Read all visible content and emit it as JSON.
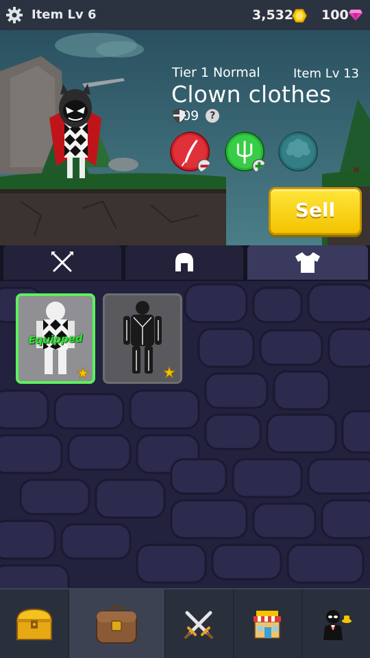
{
  "topbar": {
    "settings_icon": "gear-icon",
    "item_level": "Item Lv 6",
    "gold": "3,532",
    "gems": "100",
    "gold_icon": "gold-coin-icon",
    "gem_icon": "pink-gem-icon"
  },
  "item": {
    "tier": "Tier 1 Normal",
    "item_level": "Item Lv 13",
    "name": "Clown clothes",
    "defense": "109",
    "help": "?"
  },
  "stats": [
    {
      "icon": "feather-minus-icon",
      "color": "#d0202a"
    },
    {
      "icon": "trident-plus-icon",
      "color": "#2cc43c"
    },
    {
      "icon": "afro-hair-icon",
      "color": "#2f7f86"
    }
  ],
  "sell_button": "Sell",
  "tabs": [
    {
      "name": "weapons",
      "icon": "crossed-weapons-icon"
    },
    {
      "name": "helmets",
      "icon": "helmet-icon"
    },
    {
      "name": "armor",
      "icon": "shirt-icon",
      "active": true
    }
  ],
  "inventory": [
    {
      "name": "clown-suit",
      "equipped_label": "Equipped",
      "stars": 1,
      "equipped": true
    },
    {
      "name": "black-suit",
      "stars": 1,
      "equipped": false
    }
  ],
  "nav": [
    {
      "name": "chest",
      "icon": "treasure-chest-icon"
    },
    {
      "name": "bag",
      "icon": "backpack-icon",
      "active": true
    },
    {
      "name": "battle",
      "icon": "crossed-swords-icon"
    },
    {
      "name": "store",
      "icon": "store-icon"
    },
    {
      "name": "character",
      "icon": "butler-icon"
    }
  ],
  "colors": {
    "gold": "#f6c400",
    "gem": "#e53fb7",
    "sell": "#f3c300",
    "equipped": "#5cf25a"
  }
}
